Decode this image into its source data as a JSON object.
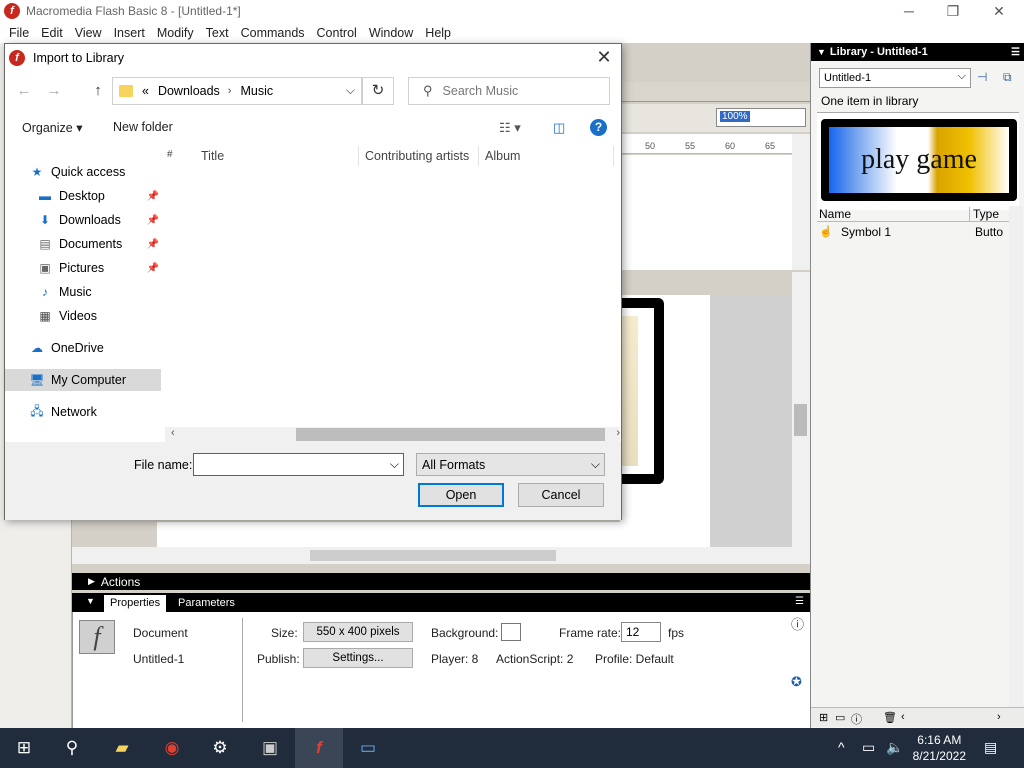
{
  "app": {
    "title": "Macromedia Flash Basic 8 - [Untitled-1*]",
    "menu": [
      "File",
      "Edit",
      "View",
      "Insert",
      "Modify",
      "Text",
      "Commands",
      "Control",
      "Window",
      "Help"
    ]
  },
  "window_controls": {
    "minimize": "─",
    "maximize": "❐",
    "close": "✕"
  },
  "workspace": {
    "zoom": "100%",
    "ruler_ticks": [
      "50",
      "55",
      "60",
      "65"
    ]
  },
  "library": {
    "title": "Library - Untitled-1",
    "selected_doc": "Untitled-1",
    "count_text": "One item in library",
    "preview_text": "play game",
    "col_name": "Name",
    "col_type": "Type",
    "items": [
      {
        "name": "Symbol 1",
        "type": "Butto"
      }
    ]
  },
  "actions": {
    "label": "Actions"
  },
  "properties": {
    "tabs": [
      "Properties",
      "Parameters"
    ],
    "doc_label": "Document",
    "doc_name": "Untitled-1",
    "size_label": "Size:",
    "size_value": "550 x 400 pixels",
    "publish_label": "Publish:",
    "settings_label": "Settings...",
    "background_label": "Background:",
    "player_text": "Player: 8",
    "actionscript_text": "ActionScript: 2",
    "profile_text": "Profile: Default",
    "framerate_label": "Frame rate:",
    "framerate_value": "12",
    "fps_label": "fps"
  },
  "dialog": {
    "title": "Import to Library",
    "breadcrumb": [
      "«",
      "Downloads",
      "Music"
    ],
    "search_placeholder": "Search Music",
    "organize": "Organize",
    "new_folder": "New folder",
    "nav_items": [
      {
        "label": "Quick access",
        "icon": "star-icon"
      },
      {
        "label": "Desktop",
        "icon": "desktop-icon"
      },
      {
        "label": "Downloads",
        "icon": "download-icon"
      },
      {
        "label": "Documents",
        "icon": "document-icon"
      },
      {
        "label": "Pictures",
        "icon": "picture-icon"
      },
      {
        "label": "Music",
        "icon": "music-icon"
      },
      {
        "label": "Videos",
        "icon": "video-icon"
      },
      {
        "label": "OneDrive",
        "icon": "cloud-icon"
      },
      {
        "label": "My Computer",
        "icon": "computer-icon"
      },
      {
        "label": "Network",
        "icon": "network-icon"
      }
    ],
    "columns": [
      "#",
      "Title",
      "Contributing artists",
      "Album"
    ],
    "filename_label": "File name:",
    "filename_value": "",
    "format": "All Formats",
    "open": "Open",
    "cancel": "Cancel"
  },
  "taskbar": {
    "time": "6:16 AM",
    "date": "8/21/2022"
  }
}
